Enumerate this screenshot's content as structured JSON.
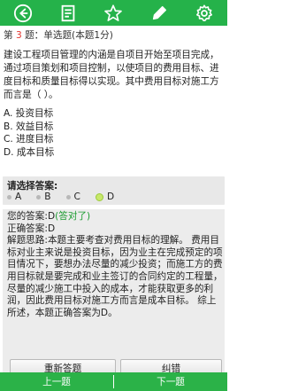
{
  "toolbar": {
    "icons": [
      "back-arrow-icon",
      "notes-icon",
      "star-icon",
      "pencil-icon",
      "gear-icon"
    ],
    "color": "#25b24a"
  },
  "question": {
    "prefix": "第",
    "number": "3",
    "suffix": "题：单选题(本题1分)",
    "text": "建设工程项目管理的内涵是自项目开始至项目完成，通过项目策划和项目控制，以使项目的费用目标、进度目标和质量目标得以实现。其中费用目标对施工方而言是（ ）。",
    "options": [
      "A. 投资目标",
      "B. 效益目标",
      "C. 进度目标",
      "D. 成本目标"
    ]
  },
  "answer_select": {
    "prompt": "请选择答案:",
    "choices": [
      "A",
      "B",
      "C",
      "D"
    ],
    "selected": "D"
  },
  "result": {
    "your_answer_label": "您的答案:D",
    "correct_tag": "(答对了)",
    "correct_answer": "正确答案:D",
    "explanation": "解题思路:本题主要考查对费用目标的理解。 费用目标对业主来说是投资目标，因为业主在完成预定的项目情况下，要想办法尽量的减少投资；而施工方的费用目标就是要完成和业主签订的合同约定的工程量，尽量的减少施工中投入的成本，才能获取更多的利润，因此费用目标对施工方而言是成本目标。 综上所述，本题正确答案为D。"
  },
  "buttons": {
    "redo": "重新答题",
    "report_error": "纠错"
  },
  "navigation": {
    "prev": "上一题",
    "next": "下一题"
  }
}
